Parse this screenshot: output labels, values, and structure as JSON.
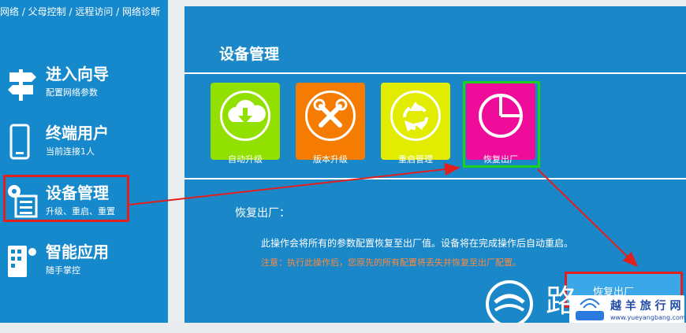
{
  "breadcrumb": "网络 / 父母控制 / 远程访问 / 网络诊断",
  "sidebar": {
    "items": [
      {
        "title": "进入向导",
        "sub": "配置网络参数",
        "icon": "signpost-icon"
      },
      {
        "title": "终端用户",
        "sub": "当前连接1人",
        "icon": "phone-icon"
      },
      {
        "title": "设备管理",
        "sub": "升级、重启、重置",
        "icon": "device-settings-icon"
      },
      {
        "title": "智能应用",
        "sub": "随手掌控",
        "icon": "apps-icon"
      }
    ]
  },
  "main": {
    "title": "设备管理",
    "tiles": [
      {
        "label": "自动升级",
        "color": "#92e000",
        "icon": "download-cloud-icon"
      },
      {
        "label": "版本升级",
        "color": "#f57c00",
        "icon": "wrench-icon"
      },
      {
        "label": "重启管理",
        "color": "#e2ec00",
        "icon": "recycle-icon"
      },
      {
        "label": "恢复出厂",
        "color": "#ef0c9a",
        "icon": "pie-chart-icon"
      }
    ],
    "section_label": "恢复出厂：",
    "description": "此操作会将所有的参数配置恢复至出厂值。设备将在完成操作后自动重启。",
    "note": "注意：执行此操作后，您原先的所有配置将丢失并恢复至出厂配置。",
    "restore_button": "恢复出厂"
  },
  "watermark": {
    "big_char": "路",
    "site_name": "越 羊 旅 行 网",
    "site_url": "www.yueyangbang.com"
  },
  "colors": {
    "sidebar_bg": "#1688cc",
    "main_bg": "#1a87c8",
    "highlight_red": "#e0201e",
    "highlight_green": "#20d020",
    "note_orange": "#ff8a3d"
  }
}
